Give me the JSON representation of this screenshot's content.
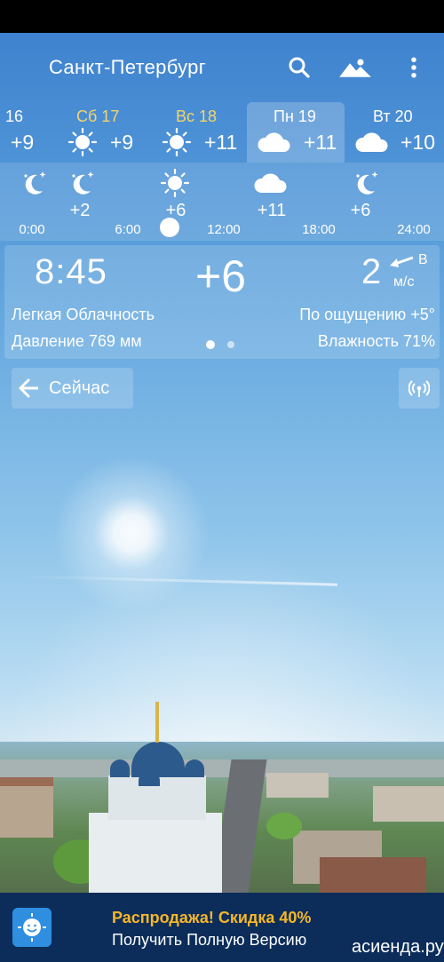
{
  "app": {
    "city": "Санкт-Петербург",
    "icons": [
      "search-icon",
      "landscape-icon",
      "more-vert-icon"
    ]
  },
  "days": [
    {
      "name": "16",
      "temp": "+9",
      "icon": "sun-icon",
      "weekend": false
    },
    {
      "name": "Сб 17",
      "temp": "+9",
      "icon": "sun-icon",
      "weekend": true
    },
    {
      "name": "Вс 18",
      "temp": "+11",
      "icon": "sun-icon",
      "weekend": true
    },
    {
      "name": "Пн 19",
      "temp": "+11",
      "icon": "cloud-icon",
      "weekend": false,
      "selected": true
    },
    {
      "name": "Вт 20",
      "temp": "+10",
      "icon": "cloud-icon",
      "weekend": false
    }
  ],
  "hourly": {
    "items": [
      {
        "icon": "moon-stars-icon",
        "temp": ""
      },
      {
        "icon": "moon-stars-icon",
        "temp": "+2"
      },
      {
        "icon": "sun-icon",
        "temp": "+6"
      },
      {
        "icon": "cloud-icon",
        "temp": "+11"
      },
      {
        "icon": "moon-stars-icon",
        "temp": "+6"
      }
    ],
    "times": [
      "0:00",
      "6:00",
      "12:00",
      "18:00",
      "24:00"
    ]
  },
  "current": {
    "time": "8:45",
    "temp": "+6",
    "wind_speed": "2",
    "wind_dir": "В",
    "wind_unit": "м/с",
    "condition": "Легкая Облачность",
    "feels_like": "По ощущению +5°",
    "pressure": "Давление 769 мм",
    "humidity": "Влажность 71%"
  },
  "now_button": {
    "label": "Сейчас"
  },
  "ad": {
    "title": "Распродажа! Скидка 40%",
    "subtitle": "Получить Полную Версию"
  },
  "watermark": "асиенда.ру",
  "colors": {
    "weekend": "#f4d46a",
    "ad_background": "#0c2d5a",
    "ad_title": "#f5b62a"
  }
}
